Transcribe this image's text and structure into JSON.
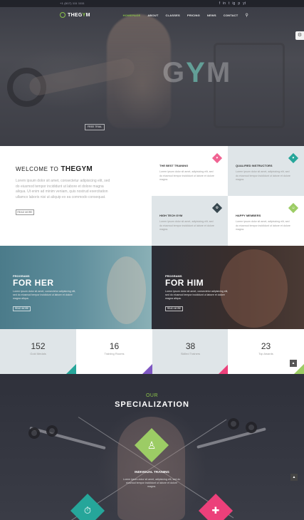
{
  "topbar": {
    "phone": "+1 (617) 111 1111",
    "social": [
      "f",
      "in",
      "t",
      "ig",
      "p",
      "yt"
    ]
  },
  "logo": {
    "prefix": "THEG",
    "accent": "Y",
    "suffix": "M"
  },
  "nav": {
    "items": [
      "HOMEPAGE",
      "ABOUT",
      "CLASSES",
      "PRICING",
      "NEWS",
      "CONTACT"
    ],
    "active_index": 0,
    "search_icon": "search-icon"
  },
  "hero": {
    "big_text_pre": "G",
    "big_text_accent": "Y",
    "big_text_post": "M",
    "button": "FREE TRIAL"
  },
  "welcome": {
    "title_light": "WELCOME TO",
    "title_bold": "THEGYM",
    "text": "Lorem ipsum dolor sit amet, consectetur adipisicing elit, sed do eiusmod tempor incididunt ut labore et dolore magna aliqua. Ut enim ad minim veniam, quis nostrud exercitation ullamco laboris nisi ut aliquip ex ea commodo consequat.",
    "button": "READ MORE"
  },
  "features": [
    {
      "title": "THE BEST TRAINING",
      "text": "Lorem ipsum dolor sit amet, adipisicing elit, sed do eiusmod tempor incididunt ut labore et dolore magna.",
      "color": "#f06292",
      "icon": "heart-icon"
    },
    {
      "title": "QUALIFIED INSTRUCTORS",
      "text": "Lorem ipsum dolor sit amet, adipisicing elit, sed do eiusmod tempor incididunt ut labore et dolore magna.",
      "color": "#26a69a",
      "icon": "heart-icon"
    },
    {
      "title": "HIGH TECH GYM",
      "text": "Lorem ipsum dolor sit amet, adipisicing elit, sed do eiusmod tempor incididunt ut labore et dolore magna.",
      "color": "#37474f",
      "icon": "gear-icon"
    },
    {
      "title": "HAPPY MEMBERS",
      "text": "Lorem ipsum dolor sit amet, adipisicing elit, sed do eiusmod tempor incididunt ut labore et dolore magna.",
      "color": "#9ccc65",
      "icon": "smile-icon"
    }
  ],
  "programs": {
    "her": {
      "small": "PROGRAMS",
      "big": "FOR HER",
      "text": "Lorem ipsum dolor sit amet, consectetur adipisicing elit, sed do eiusmod tempor incididunt ut labore et dolore magna aliqua.",
      "button": "READ MORE"
    },
    "him": {
      "small": "PROGRAMS",
      "big": "FOR HIM",
      "text": "Lorem ipsum dolor sit amet, consectetur adipisicing elit, sed do eiusmod tempor incididunt ut labore et dolore magna aliqua.",
      "button": "READ MORE"
    }
  },
  "stats": [
    {
      "num": "152",
      "label": "Gold Medals",
      "bg": "#dfe5e8",
      "corner": "#26a69a"
    },
    {
      "num": "16",
      "label": "Training Rooms",
      "bg": "#ffffff",
      "corner": "#7e57c2"
    },
    {
      "num": "38",
      "label": "Skilled Trainers",
      "bg": "#dfe5e8",
      "corner": "#ec407a"
    },
    {
      "num": "23",
      "label": "Top Awards",
      "bg": "#ffffff",
      "corner": "#9ccc65"
    }
  ],
  "specialization": {
    "over": "OUR",
    "title": "SPECIALIZATION",
    "item_title": "INDIVIDUAL TRAINING",
    "item_text": "Lorem ipsum dolor sit amet, adipisicing elit, sed do eiusmod tempor incididunt ut labore et dolore magna.",
    "colors": {
      "center": "#9ccc65",
      "left": "#26a69a",
      "right": "#ec407a"
    }
  }
}
